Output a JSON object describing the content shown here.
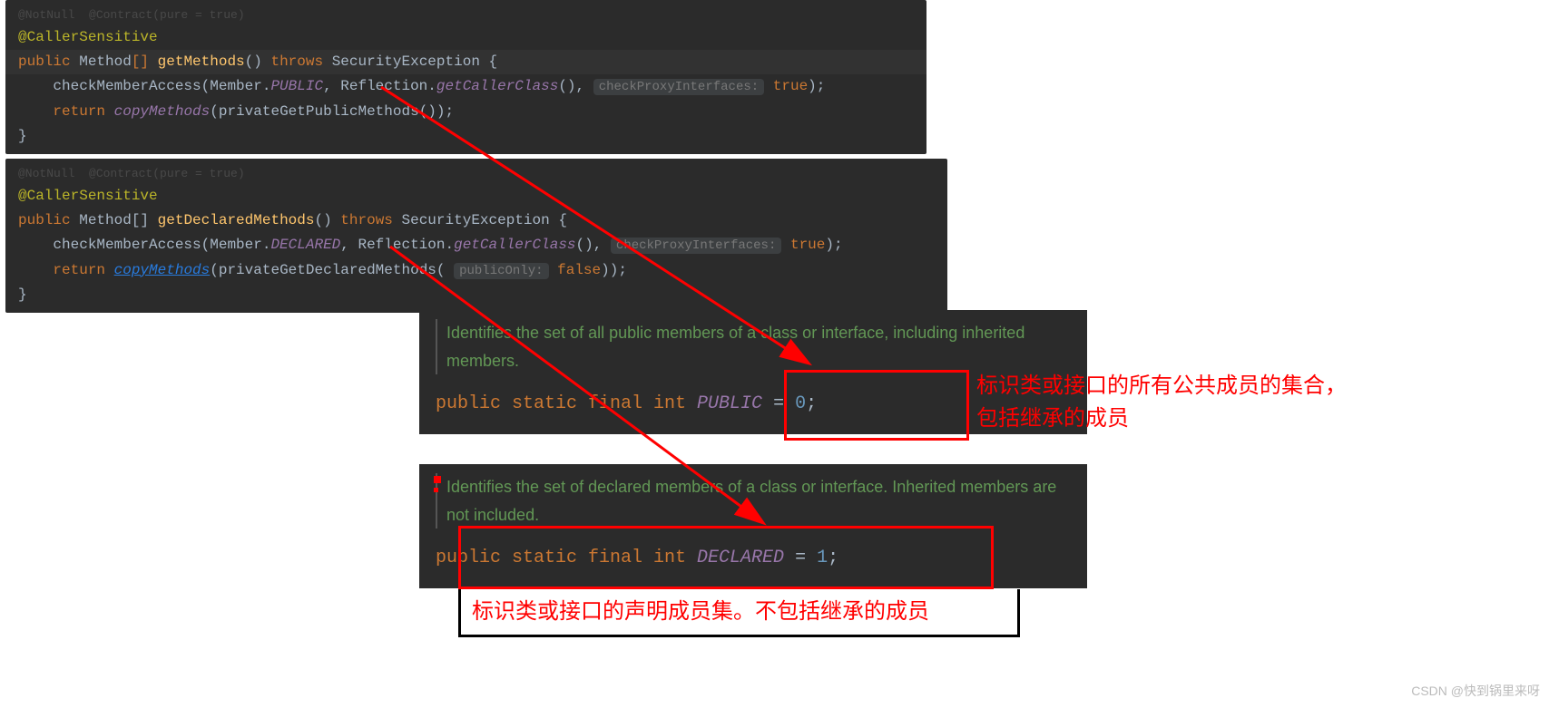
{
  "block1": {
    "faded": "@NotNull  @Contract(pure = true)",
    "annot": "@CallerSensitive",
    "l2_kw": "public ",
    "l2_type": "Method",
    "l2_br": "[] ",
    "l2_m": "getMethods",
    "l2_paren": "() ",
    "l2_throws": "throws ",
    "l2_exc": "SecurityException {",
    "l3_a": "    checkMemberAccess(Member.",
    "l3_const": "PUBLIC",
    "l3_b": ", Reflection.",
    "l3_call": "getCallerClass",
    "l3_c": "(), ",
    "l3_hint": "checkProxyInterfaces:",
    "l3_sp": " ",
    "l3_bool": "true",
    "l3_end": ");",
    "l4_a": "    ",
    "l4_kw": "return ",
    "l4_call": "copyMethods",
    "l4_b": "(privateGetPublicMethods());",
    "l5": "}"
  },
  "block2": {
    "faded": "@NotNull  @Contract(pure = true)",
    "annot": "@CallerSensitive",
    "l2_kw": "public ",
    "l2_type": "Method[] ",
    "l2_m": "getDeclaredMethods",
    "l2_paren": "() ",
    "l2_throws": "throws ",
    "l2_exc": "SecurityException {",
    "l3_a": "    checkMemberAccess(Member.",
    "l3_const": "DECLARED",
    "l3_b": ", Reflection.",
    "l3_call": "getCallerClass",
    "l3_c": "(), ",
    "l3_hint": "checkProxyInterfaces:",
    "l3_sp": " ",
    "l3_bool": "true",
    "l3_end": ");",
    "l4_a": "    ",
    "l4_kw": "return ",
    "l4_link": "copyMethods",
    "l4_b": "(privateGetDeclaredMethods( ",
    "l4_hint": "publicOnly:",
    "l4_sp": " ",
    "l4_bool": "false",
    "l4_end": "));",
    "l5": "}"
  },
  "doc1": {
    "comment": "Identifies the set of all public members of a class or interface, including inherited members.",
    "kw": "public static final int ",
    "name": "PUBLIC",
    "eq": " = ",
    "val": "0",
    "semi": ";"
  },
  "doc2": {
    "comment": "Identifies the set of declared members of a class or interface. Inherited members are not included.",
    "kw": "public static final int ",
    "name": "DECLARED",
    "eq": " = ",
    "val": "1",
    "semi": ";"
  },
  "annot1_l1": "标识类或接口的所有公共成员的集合，",
  "annot1_l2": "包括继承的成员",
  "annot2": "标识类或接口的声明成员集。不包括继承的成员",
  "watermark": "CSDN @快到锅里来呀"
}
